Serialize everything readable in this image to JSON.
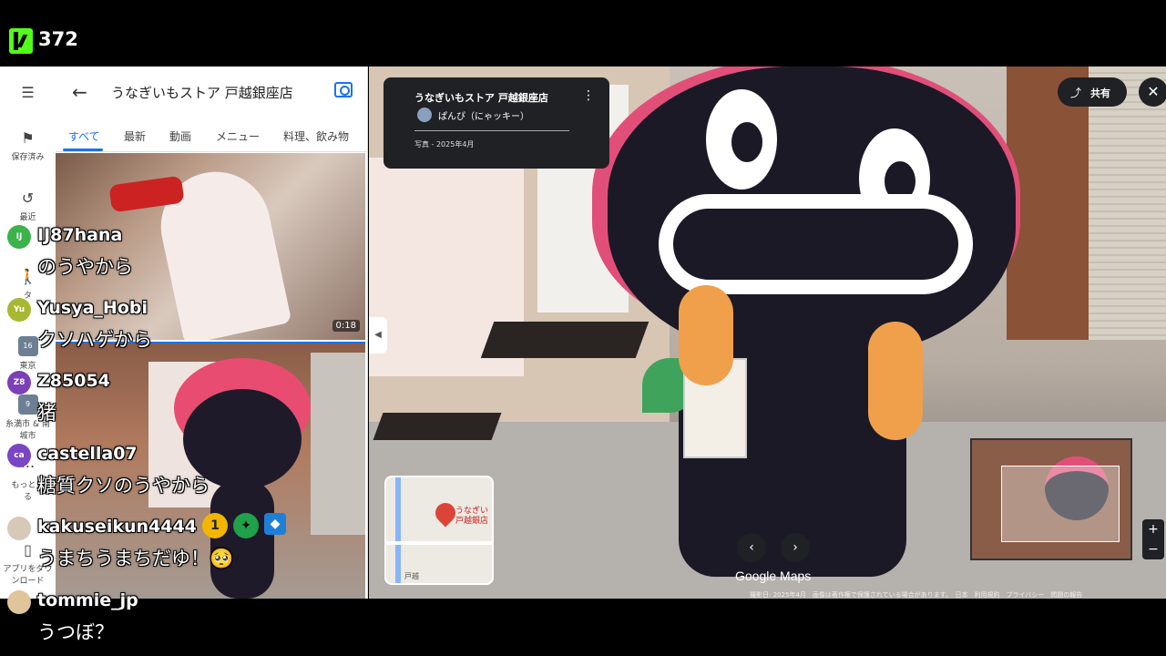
{
  "stream": {
    "viewer_count": "372"
  },
  "rail": {
    "items": [
      {
        "label": "保存済み",
        "icon": "bookmark-icon"
      },
      {
        "label": "最近",
        "icon": "history-icon"
      },
      {
        "label": "タ",
        "icon": "walk-icon"
      },
      {
        "label": "東京",
        "icon": "calendar-icon"
      },
      {
        "label": "糸満市 & 南城市",
        "icon": "place-icon"
      },
      {
        "label": "もっと見る",
        "icon": "more-icon"
      },
      {
        "label": "アプリをダウンロード",
        "icon": "phone-icon"
      }
    ],
    "date_badge_1": "16",
    "date_badge_2": "9"
  },
  "panel": {
    "title": "うなぎいもストア 戸越銀座店",
    "tabs": [
      "すべて",
      "最新",
      "動画",
      "メニュー",
      "料理、飲み物"
    ],
    "video_duration": "0:18"
  },
  "street_view": {
    "info_title": "うなぎいもストア 戸越銀座店",
    "author": "ぱんぴ（にゃッキー）",
    "date": "写真 - 2025年4月",
    "share_label": "共有",
    "close": "✕",
    "prev": "‹",
    "next": "›",
    "logo": "Google Maps",
    "footer": "撮影日: 2025年4月　画像は著作権で保護されている場合があります。　日本　利用規約　プライバシー　問題の報告",
    "minimap_label": "うなぎい\n戸越銀店",
    "minimap_street": "戸越",
    "zoom_in": "+",
    "zoom_out": "−"
  },
  "chat": [
    {
      "user": "IJ87hana",
      "initials": "IJ",
      "avatar_color": "#3bb34a",
      "message": "のうやから"
    },
    {
      "user": "Yusya_Hobi",
      "initials": "Yu",
      "avatar_color": "#a8b832",
      "message": "クソハゲから"
    },
    {
      "user": "Z85054",
      "initials": "Z8",
      "avatar_color": "#7b3fb8",
      "message": "猪"
    },
    {
      "user": "castella07",
      "initials": "ca",
      "avatar_color": "#7a45c4",
      "message": "糖質クソのうやから"
    },
    {
      "user": "kakuseikun4444",
      "initials": "",
      "avatar_color": "#d6c9b8",
      "message": "うまちうまちだゆ！🥺"
    },
    {
      "user": "tommie_jp",
      "initials": "",
      "avatar_color": "#e0c49a",
      "message": "うつぼ？"
    }
  ],
  "colors": {
    "kick_green": "#53fc18",
    "maps_blue": "#1a73e8",
    "mascot_pink": "#e14f78"
  }
}
